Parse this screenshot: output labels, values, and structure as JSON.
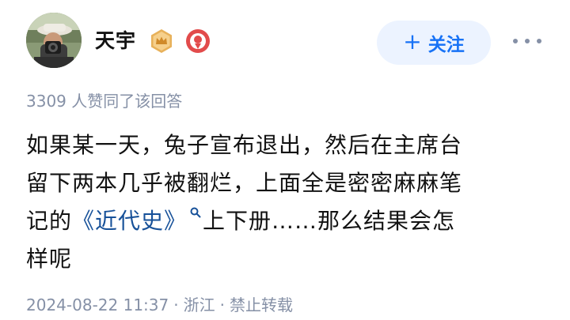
{
  "author": {
    "name": "天宇"
  },
  "follow_button": {
    "label": "关注"
  },
  "upvote_text": "3309 人赞同了该回答",
  "answer": {
    "line1": "如果某一天，兔子宣布退出，然后在主席台",
    "line2": "留下两本几乎被翻烂，上面全是密密麻麻笔",
    "line3_before": "记的",
    "book_link": "《近代史》",
    "line3_after": "上下册……那么结果会怎",
    "line4": "样呢"
  },
  "meta": {
    "time": "2024-08-22 11:37",
    "location": "浙江",
    "copyright": "禁止转载"
  },
  "colors": {
    "accent": "#1772f6",
    "link": "#175199",
    "muted": "#8590a6",
    "text": "#121212",
    "follow_bg": "#ecf3ff"
  },
  "icons": [
    "avatar-photo",
    "level-badge-icon",
    "medal-badge-icon",
    "plus-icon",
    "more-icon",
    "search-icon"
  ]
}
